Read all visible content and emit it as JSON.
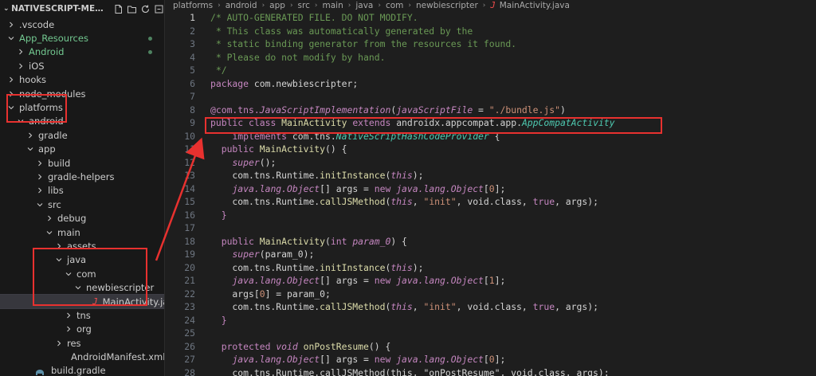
{
  "sidebar": {
    "title": "NATIVESCRIPT-META-I...",
    "rows": [
      {
        "label": ".vscode",
        "depth": 0,
        "tw": ">",
        "cls": ""
      },
      {
        "label": "App_Resources",
        "depth": 0,
        "tw": "v",
        "cls": "git",
        "dot": true
      },
      {
        "label": "Android",
        "depth": 1,
        "tw": ">",
        "cls": "git",
        "dot": true
      },
      {
        "label": "iOS",
        "depth": 1,
        "tw": ">",
        "cls": ""
      },
      {
        "label": "hooks",
        "depth": 0,
        "tw": ">",
        "cls": ""
      },
      {
        "label": "node_modules",
        "depth": 0,
        "tw": ">",
        "cls": ""
      },
      {
        "label": "platforms",
        "depth": 0,
        "tw": "v",
        "cls": ""
      },
      {
        "label": "android",
        "depth": 1,
        "tw": "v",
        "cls": ""
      },
      {
        "label": "gradle",
        "depth": 2,
        "tw": ">",
        "cls": ""
      },
      {
        "label": "app",
        "depth": 2,
        "tw": "v",
        "cls": ""
      },
      {
        "label": "build",
        "depth": 3,
        "tw": ">",
        "cls": ""
      },
      {
        "label": "gradle-helpers",
        "depth": 3,
        "tw": ">",
        "cls": ""
      },
      {
        "label": "libs",
        "depth": 3,
        "tw": ">",
        "cls": ""
      },
      {
        "label": "src",
        "depth": 3,
        "tw": "v",
        "cls": ""
      },
      {
        "label": "debug",
        "depth": 4,
        "tw": ">",
        "cls": ""
      },
      {
        "label": "main",
        "depth": 4,
        "tw": "v",
        "cls": ""
      },
      {
        "label": "assets",
        "depth": 5,
        "tw": ">",
        "cls": ""
      },
      {
        "label": "java",
        "depth": 5,
        "tw": "v",
        "cls": ""
      },
      {
        "label": "com",
        "depth": 6,
        "tw": "v",
        "cls": ""
      },
      {
        "label": "newbiescripter",
        "depth": 7,
        "tw": "v",
        "cls": ""
      },
      {
        "label": "MainActivity.java",
        "depth": 8,
        "tw": "",
        "cls": "selected",
        "icon": "java"
      },
      {
        "label": "tns",
        "depth": 6,
        "tw": ">",
        "cls": ""
      },
      {
        "label": "org",
        "depth": 6,
        "tw": ">",
        "cls": ""
      },
      {
        "label": "res",
        "depth": 5,
        "tw": ">",
        "cls": ""
      },
      {
        "label": "AndroidManifest.xml",
        "depth": 5,
        "tw": "",
        "cls": "",
        "icon": "xml"
      },
      {
        "label": "build.gradle",
        "depth": 2,
        "tw": "",
        "cls": "",
        "icon": "gradle"
      }
    ]
  },
  "breadcrumb": [
    "platforms",
    "android",
    "app",
    "src",
    "main",
    "java",
    "com",
    "newbiescripter"
  ],
  "breadcrumb_file": "MainActivity.java",
  "breadcrumb_file_icon": "J",
  "code": {
    "active_line": 1,
    "lines": [
      [
        [
          "com",
          "/* AUTO-GENERATED FILE. DO NOT MODIFY."
        ]
      ],
      [
        [
          "com",
          " * This class was automatically generated by the"
        ]
      ],
      [
        [
          "com",
          " * static binding generator from the resources it found."
        ]
      ],
      [
        [
          "com",
          " * Please do not modify by hand."
        ]
      ],
      [
        [
          "com",
          " */"
        ]
      ],
      [
        [
          "kk",
          "package"
        ],
        [
          "white",
          " com.newbiescripter;"
        ]
      ],
      [],
      [
        [
          "ann",
          "@com.tns."
        ],
        [
          "ann it",
          "JavaScriptImplementation"
        ],
        [
          "white",
          "("
        ],
        [
          "ann it",
          "javaScriptFile"
        ],
        [
          "white",
          " = "
        ],
        [
          "str",
          "\"./bundle.js\""
        ],
        [
          "white",
          ")"
        ]
      ],
      [
        [
          "kk",
          "public"
        ],
        [
          "white",
          " "
        ],
        [
          "kk",
          "class"
        ],
        [
          "white",
          " "
        ],
        [
          "fn",
          "MainActivity"
        ],
        [
          "white",
          " "
        ],
        [
          "kk",
          "extends"
        ],
        [
          "white",
          " androidx.appcompat.app."
        ],
        [
          "grn",
          "AppCompatActivity"
        ]
      ],
      [
        [
          "white",
          "    "
        ],
        [
          "kk",
          "implements"
        ],
        [
          "white",
          " com.tns."
        ],
        [
          "grn",
          "NativeScriptHashCodeProvider"
        ],
        [
          "white",
          " {"
        ]
      ],
      [
        [
          "white",
          "  "
        ],
        [
          "kk",
          "public"
        ],
        [
          "white",
          " "
        ],
        [
          "fn",
          "MainActivity"
        ],
        [
          "white",
          "() {"
        ]
      ],
      [
        [
          "white",
          "    "
        ],
        [
          "kk it",
          "super"
        ],
        [
          "white",
          "();"
        ]
      ],
      [
        [
          "white",
          "    com.tns.Runtime."
        ],
        [
          "fn",
          "initInstance"
        ],
        [
          "white",
          "("
        ],
        [
          "kk it",
          "this"
        ],
        [
          "white",
          ");"
        ]
      ],
      [
        [
          "white",
          "    "
        ],
        [
          "kk it",
          "java.lang.Object"
        ],
        [
          "white",
          "[] args = "
        ],
        [
          "kk",
          "new"
        ],
        [
          "white",
          " "
        ],
        [
          "kk it",
          "java.lang.Object"
        ],
        [
          "white",
          "["
        ],
        [
          "str",
          "0"
        ],
        [
          "white",
          "];"
        ]
      ],
      [
        [
          "white",
          "    com.tns.Runtime."
        ],
        [
          "fn",
          "callJSMethod"
        ],
        [
          "white",
          "("
        ],
        [
          "kk it",
          "this"
        ],
        [
          "white",
          ", "
        ],
        [
          "str",
          "\"init\""
        ],
        [
          "white",
          ", void.class, "
        ],
        [
          "kk",
          "true"
        ],
        [
          "white",
          ", args);"
        ]
      ],
      [
        [
          "white",
          "  "
        ],
        [
          "kk",
          "}"
        ]
      ],
      [],
      [
        [
          "white",
          "  "
        ],
        [
          "kk",
          "public"
        ],
        [
          "white",
          " "
        ],
        [
          "fn",
          "MainActivity"
        ],
        [
          "white",
          "("
        ],
        [
          "kk",
          "int"
        ],
        [
          "white",
          " "
        ],
        [
          "kk it",
          "param_0"
        ],
        [
          "white",
          ") {"
        ]
      ],
      [
        [
          "white",
          "    "
        ],
        [
          "kk it",
          "super"
        ],
        [
          "white",
          "(param_0);"
        ]
      ],
      [
        [
          "white",
          "    com.tns.Runtime."
        ],
        [
          "fn",
          "initInstance"
        ],
        [
          "white",
          "("
        ],
        [
          "kk it",
          "this"
        ],
        [
          "white",
          ");"
        ]
      ],
      [
        [
          "white",
          "    "
        ],
        [
          "kk it",
          "java.lang.Object"
        ],
        [
          "white",
          "[] args = "
        ],
        [
          "kk",
          "new"
        ],
        [
          "white",
          " "
        ],
        [
          "kk it",
          "java.lang.Object"
        ],
        [
          "white",
          "["
        ],
        [
          "str",
          "1"
        ],
        [
          "white",
          "];"
        ]
      ],
      [
        [
          "white",
          "    args["
        ],
        [
          "str",
          "0"
        ],
        [
          "white",
          "] = param_0;"
        ]
      ],
      [
        [
          "white",
          "    com.tns.Runtime."
        ],
        [
          "fn",
          "callJSMethod"
        ],
        [
          "white",
          "("
        ],
        [
          "kk it",
          "this"
        ],
        [
          "white",
          ", "
        ],
        [
          "str",
          "\"init\""
        ],
        [
          "white",
          ", void.class, "
        ],
        [
          "kk",
          "true"
        ],
        [
          "white",
          ", args);"
        ]
      ],
      [
        [
          "white",
          "  "
        ],
        [
          "kk",
          "}"
        ]
      ],
      [],
      [
        [
          "white",
          "  "
        ],
        [
          "kk",
          "protected"
        ],
        [
          "white",
          " "
        ],
        [
          "kk it",
          "void"
        ],
        [
          "white",
          " "
        ],
        [
          "fn",
          "onPostResume"
        ],
        [
          "white",
          "() {"
        ]
      ],
      [
        [
          "white",
          "    "
        ],
        [
          "kk it",
          "java.lang.Object"
        ],
        [
          "white",
          "[] args = "
        ],
        [
          "kk",
          "new"
        ],
        [
          "white",
          " "
        ],
        [
          "kk it",
          "java.lang.Object"
        ],
        [
          "white",
          "["
        ],
        [
          "str",
          "0"
        ],
        [
          "white",
          "];"
        ]
      ],
      [
        [
          "white",
          "    com.tns.Runtime.callJSMethod(this, \"onPostResume\", void.class, args);"
        ]
      ]
    ]
  },
  "colors": {
    "annotation_red": "#e8312f",
    "sidebar_bg": "#181818",
    "editor_bg": "#1e1e1e"
  }
}
